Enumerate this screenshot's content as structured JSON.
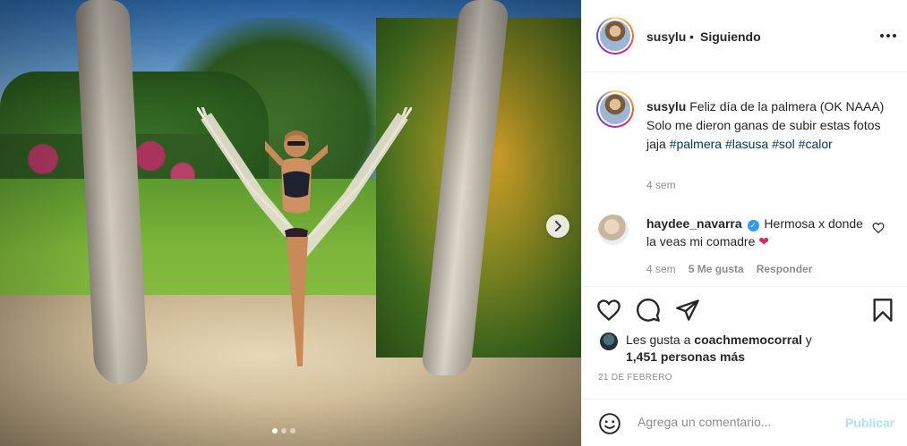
{
  "post": {
    "username": "susylu",
    "separator": "•",
    "follow_status": "Siguiendo",
    "more_icon": "more-horizontal-icon"
  },
  "photo": {
    "next_icon": "chevron-right-icon",
    "carousel_dots": 3,
    "active_dot": 1
  },
  "caption": {
    "username": "susylu",
    "text": "Feliz día de la palmera (OK NAAA) Solo me dieron ganas de subir estas fotos jaja",
    "hashtags": [
      "#palmera",
      "#lasusa",
      "#sol",
      "#calor"
    ],
    "time": "4 sem"
  },
  "comment": {
    "username": "haydee_navarra",
    "verified": true,
    "text": "Hermosa x donde la veas mi comadre",
    "emoji": "❤",
    "time": "4 sem",
    "likes": "5 Me gusta",
    "reply": "Responder"
  },
  "actions": {
    "like_icon": "heart-icon",
    "comment_icon": "comment-icon",
    "share_icon": "paper-plane-icon",
    "save_icon": "bookmark-icon"
  },
  "likes": {
    "prefix": "Les gusta a",
    "user": "coachmemocorral",
    "connector": "y",
    "others": "1,451 personas más"
  },
  "date": "21 DE FEBRERO",
  "add_comment": {
    "placeholder": "Agrega un comentario...",
    "post_label": "Publicar"
  },
  "colors": {
    "link": "#00376b",
    "muted": "#8e8e8e",
    "post_disabled": "#b2dffc",
    "verified": "#3897f0"
  }
}
